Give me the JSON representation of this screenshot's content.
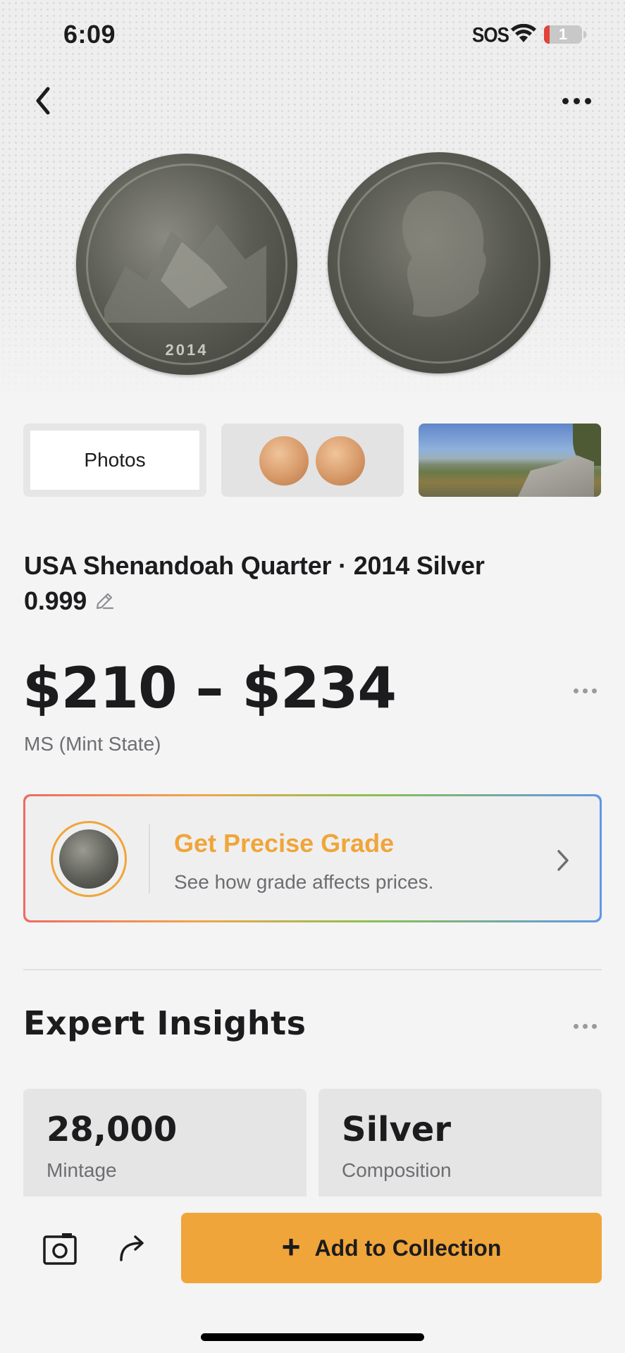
{
  "status_bar": {
    "time": "6:09",
    "carrier": "SOS",
    "battery_level": "1"
  },
  "nav": {
    "back_icon": "chevron-left-icon",
    "more_icon": "ellipsis-icon"
  },
  "hero": {
    "reverse_year": "2014"
  },
  "thumbnails": {
    "photos_label": "Photos"
  },
  "coin": {
    "title": "USA Shenandoah Quarter · 2014 Silver 0.999",
    "price_range": "$210 – $234",
    "grade": "MS (Mint State)"
  },
  "grade_card": {
    "title": "Get Precise Grade",
    "subtitle": "See how grade affects prices."
  },
  "insights": {
    "title": "Expert Insights",
    "stats": [
      {
        "value": "28,000",
        "label": "Mintage"
      },
      {
        "value": "Silver",
        "label": "Composition"
      }
    ]
  },
  "bottom_bar": {
    "add_label": "Add to Collection",
    "add_icon": "plus-icon",
    "camera_icon": "camera-icon",
    "share_icon": "share-icon"
  },
  "colors": {
    "accent": "#F0A53A",
    "background": "#F4F4F4",
    "text": "#1C1C1E",
    "secondary_text": "#6D6D72"
  }
}
